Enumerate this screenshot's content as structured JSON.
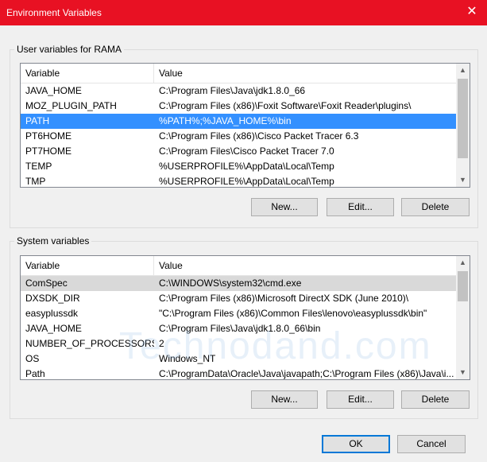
{
  "window": {
    "title": "Environment Variables"
  },
  "user_group": {
    "label": "User variables for RAMA",
    "columns": [
      "Variable",
      "Value"
    ],
    "rows": [
      {
        "variable": "JAVA_HOME",
        "value": "C:\\Program Files\\Java\\jdk1.8.0_66"
      },
      {
        "variable": "MOZ_PLUGIN_PATH",
        "value": "C:\\Program Files (x86)\\Foxit Software\\Foxit Reader\\plugins\\"
      },
      {
        "variable": "PATH",
        "value": "%PATH%;%JAVA_HOME%\\bin"
      },
      {
        "variable": "PT6HOME",
        "value": "C:\\Program Files (x86)\\Cisco Packet Tracer 6.3"
      },
      {
        "variable": "PT7HOME",
        "value": "C:\\Program Files\\Cisco Packet Tracer 7.0"
      },
      {
        "variable": "TEMP",
        "value": "%USERPROFILE%\\AppData\\Local\\Temp"
      },
      {
        "variable": "TMP",
        "value": "%USERPROFILE%\\AppData\\Local\\Temp"
      }
    ],
    "buttons": {
      "new": "New...",
      "edit": "Edit...",
      "delete": "Delete"
    }
  },
  "system_group": {
    "label": "System variables",
    "columns": [
      "Variable",
      "Value"
    ],
    "rows": [
      {
        "variable": "ComSpec",
        "value": "C:\\WINDOWS\\system32\\cmd.exe"
      },
      {
        "variable": "DXSDK_DIR",
        "value": "C:\\Program Files (x86)\\Microsoft DirectX SDK (June 2010)\\"
      },
      {
        "variable": "easyplussdk",
        "value": "\"C:\\Program Files (x86)\\Common Files\\lenovo\\easyplussdk\\bin\""
      },
      {
        "variable": "JAVA_HOME",
        "value": "C:\\Program Files\\Java\\jdk1.8.0_66\\bin"
      },
      {
        "variable": "NUMBER_OF_PROCESSORS",
        "value": "2"
      },
      {
        "variable": "OS",
        "value": "Windows_NT"
      },
      {
        "variable": "Path",
        "value": "C:\\ProgramData\\Oracle\\Java\\javapath;C:\\Program Files (x86)\\Java\\i..."
      }
    ],
    "buttons": {
      "new": "New...",
      "edit": "Edit...",
      "delete": "Delete"
    }
  },
  "footer": {
    "ok": "OK",
    "cancel": "Cancel"
  },
  "watermark": "Technodand.com",
  "colors": {
    "titlebar": "#e81123",
    "selection": "#3390ff",
    "default_button_border": "#0078d7"
  },
  "icons": {
    "close": "close-icon",
    "scroll_up": "chevron-up-icon",
    "scroll_down": "chevron-down-icon"
  }
}
